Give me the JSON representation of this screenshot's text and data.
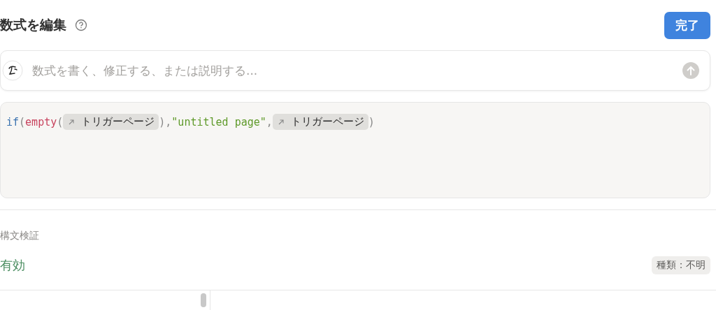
{
  "header": {
    "title": "数式を編集",
    "done_button": "完了"
  },
  "ai_input": {
    "placeholder": "数式を書く、修正する、または説明する..."
  },
  "formula": [
    {
      "kind": "keyword",
      "text": "if"
    },
    {
      "kind": "punct",
      "text": "("
    },
    {
      "kind": "function",
      "text": "empty"
    },
    {
      "kind": "punct",
      "text": "("
    },
    {
      "kind": "mention",
      "text": "トリガーページ"
    },
    {
      "kind": "punct",
      "text": "),"
    },
    {
      "kind": "string",
      "text": "\"untitled page\""
    },
    {
      "kind": "punct",
      "text": ","
    },
    {
      "kind": "mention",
      "text": "トリガーページ"
    },
    {
      "kind": "punct",
      "text": ")"
    }
  ],
  "validation": {
    "label": "構文検証",
    "status": "有効",
    "valid": true,
    "type_badge": "種類：不明"
  }
}
